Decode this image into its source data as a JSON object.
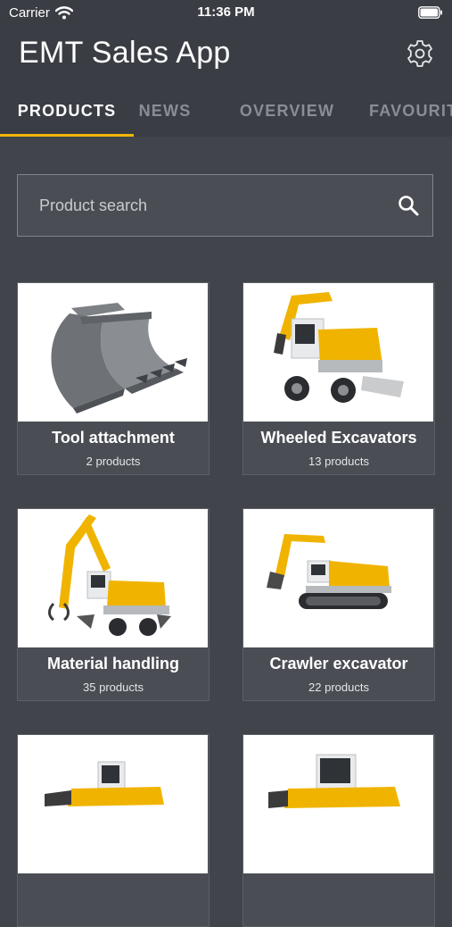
{
  "status_bar": {
    "carrier": "Carrier",
    "time": "11:36 PM"
  },
  "header": {
    "title": "EMT Sales App",
    "settings_icon": "gear-icon"
  },
  "tabs": [
    {
      "label": "PRODUCTS",
      "active": true
    },
    {
      "label": "NEWS",
      "active": false
    },
    {
      "label": "OVERVIEW",
      "active": false
    },
    {
      "label": "FAVOURITES",
      "active": false
    }
  ],
  "search": {
    "placeholder": "Product search",
    "icon": "search-icon"
  },
  "products": [
    {
      "title": "Tool attachment",
      "count": "2 products",
      "image": "bucket-attachment"
    },
    {
      "title": "Wheeled Excavators",
      "count": "13 products",
      "image": "wheeled-excavator"
    },
    {
      "title": "Material handling",
      "count": "35 products",
      "image": "material-handler"
    },
    {
      "title": "Crawler excavator",
      "count": "22 products",
      "image": "crawler-excavator"
    },
    {
      "title": "",
      "count": "",
      "image": "wheel-loader"
    },
    {
      "title": "",
      "count": "",
      "image": "crawler-dozer"
    }
  ],
  "colors": {
    "background": "#41454b",
    "accent": "#f2b70a",
    "machine_yellow": "#f0b400",
    "inactive_tab": "#8a8e94"
  }
}
